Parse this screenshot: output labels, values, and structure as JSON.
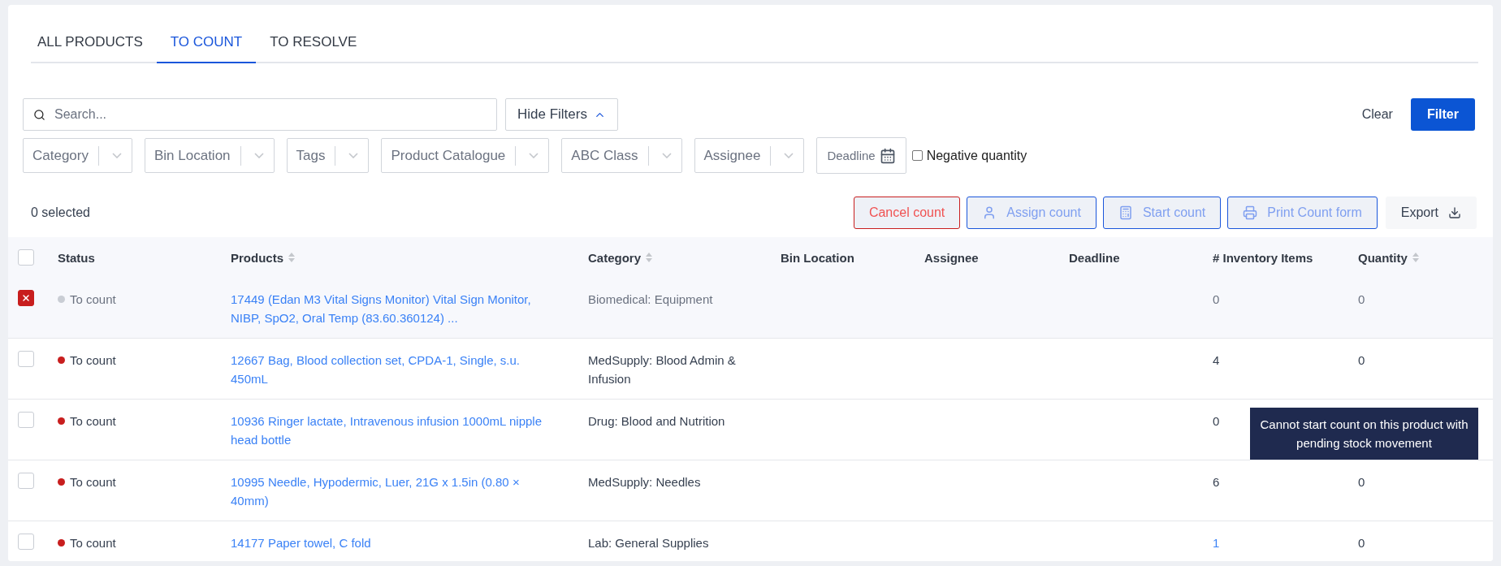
{
  "tabs": [
    {
      "label": "ALL PRODUCTS",
      "selected": false
    },
    {
      "label": "TO COUNT",
      "selected": true
    },
    {
      "label": "TO RESOLVE",
      "selected": false
    }
  ],
  "search": {
    "placeholder": "Search..."
  },
  "hide_filters": {
    "label": "Hide Filters",
    "expanded": true
  },
  "filters": [
    {
      "kind": "select",
      "placeholder": "Category"
    },
    {
      "kind": "select",
      "placeholder": "Bin Location"
    },
    {
      "kind": "select",
      "placeholder": "Tags"
    },
    {
      "kind": "select",
      "placeholder": "Product Catalogue"
    },
    {
      "kind": "select",
      "placeholder": "ABC Class"
    },
    {
      "kind": "select",
      "placeholder": "Assignee"
    },
    {
      "kind": "date",
      "placeholder": "Deadline"
    },
    {
      "kind": "checkbox",
      "label": "Negative quantity",
      "checked": false
    }
  ],
  "clear": "Clear",
  "filter": "Filter",
  "selected_count": "0 selected",
  "actions": [
    {
      "kind": "danger",
      "label": "Cancel count"
    },
    {
      "kind": "assign",
      "label": "Assign count"
    },
    {
      "kind": "start",
      "label": "Start count"
    },
    {
      "kind": "print",
      "label": "Print Count form"
    },
    {
      "kind": "export",
      "label": "Export"
    }
  ],
  "table": {
    "all_selected": false,
    "columns": [
      {
        "label": "Status",
        "sortable": false
      },
      {
        "label": "Products",
        "sortable": true
      },
      {
        "label": "Category",
        "sortable": true
      },
      {
        "label": "Bin Location",
        "sortable": false
      },
      {
        "label": "Assignee",
        "sortable": false
      },
      {
        "label": "Deadline",
        "sortable": false
      },
      {
        "label": "# Inventory Items",
        "sortable": false
      },
      {
        "label": "Quantity",
        "sortable": true
      }
    ],
    "rows": [
      {
        "blocked": true,
        "status": "To count",
        "color": "#c9cdd4",
        "product": "17449 (Edan M3 Vital Signs Monitor) Vital Sign Monitor, NIBP, SpO2, Oral Temp (83.60.360124) ...",
        "category": "Biomedical: Equipment",
        "inventory_items": "0",
        "inventory_link": false,
        "quantity": "0"
      },
      {
        "blocked": false,
        "status": "To count",
        "color": "#c81e1e",
        "product": "12667 Bag, Blood collection set, CPDA-1, Single, s.u. 450mL",
        "category": "MedSupply: Blood Admin & Infusion",
        "inventory_items": "4",
        "inventory_link": false,
        "quantity": "0"
      },
      {
        "blocked": false,
        "status": "To count",
        "color": "#c81e1e",
        "product": "10936 Ringer lactate, Intravenous infusion 1000mL nipple head bottle",
        "category": "Drug: Blood and Nutrition",
        "inventory_items": "0",
        "inventory_link": false
      },
      {
        "blocked": false,
        "status": "To count",
        "color": "#c81e1e",
        "product": "10995 Needle, Hypodermic, Luer, 21G x 1.5in (0.80 × 40mm)",
        "category": "MedSupply: Needles",
        "inventory_items": "6",
        "inventory_link": false,
        "quantity": "0"
      },
      {
        "blocked": false,
        "status": "To count",
        "color": "#c81e1e",
        "product": "14177 Paper towel, C fold",
        "category": "Lab: General Supplies",
        "inventory_items": "1",
        "inventory_link": true,
        "quantity": "0"
      }
    ]
  },
  "tooltip": "Cannot start count on this product with pending stock movement"
}
